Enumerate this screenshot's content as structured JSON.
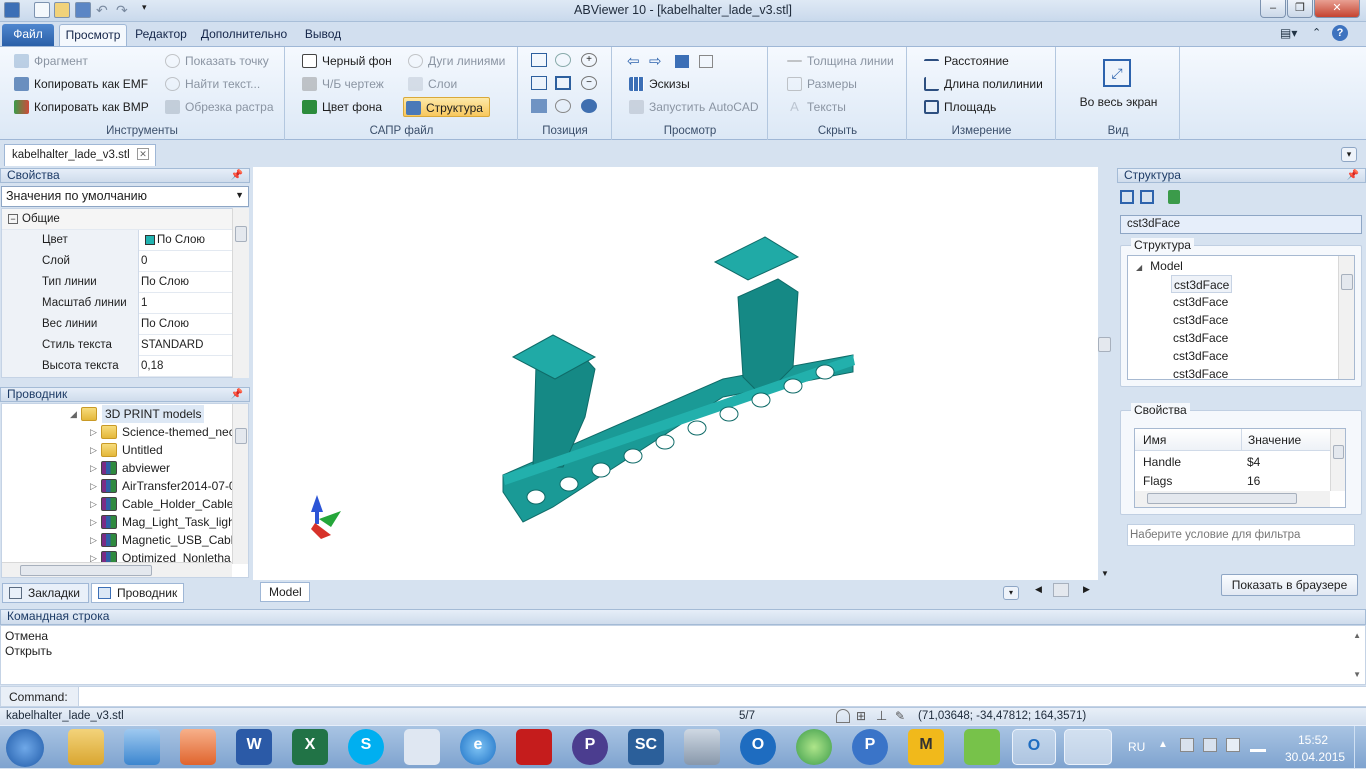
{
  "window": {
    "title": "ABViewer 10 - [kabelhalter_lade_v3.stl]",
    "controls": [
      "–",
      "❐",
      "✕"
    ]
  },
  "quick_access": {
    "icons": [
      "new-icon",
      "open-icon",
      "save-icon",
      "undo-icon",
      "redo-icon",
      "customize-icon"
    ]
  },
  "ribbon": {
    "tabs": [
      "Файл",
      "Просмотр",
      "Редактор",
      "Дополнительно",
      "Вывод"
    ],
    "active_tab": "Просмотр",
    "groups": {
      "tools": {
        "title": "Инструменты",
        "items": [
          "Фрагмент",
          "Копировать как EMF",
          "Копировать как BMP",
          "Показать точку",
          "Найти текст...",
          "Обрезка растра"
        ]
      },
      "cad": {
        "title": "САПР файл",
        "items": [
          "Черный фон",
          "Ч/Б чертеж",
          "Цвет фона",
          "Дуги линиями",
          "Слои",
          "Структура"
        ]
      },
      "position": {
        "title": "Позиция"
      },
      "viewing": {
        "title": "Просмотр",
        "items": [
          "Эскизы",
          "Запустить AutoCAD"
        ]
      },
      "hide": {
        "title": "Скрыть",
        "items": [
          "Толщина линии",
          "Размеры",
          "Тексты"
        ]
      },
      "measure": {
        "title": "Измерение",
        "items": [
          "Расстояние",
          "Длина полилинии",
          "Площадь"
        ]
      },
      "view": {
        "title": "Вид",
        "items": [
          "Во весь экран"
        ]
      }
    }
  },
  "document_tab": {
    "name": "kabelhalter_lade_v3.stl"
  },
  "properties_panel": {
    "title": "Свойства",
    "combo": "Значения по умолчанию",
    "section": "Общие",
    "rows": [
      {
        "key": "Цвет",
        "value": "По Слою"
      },
      {
        "key": "Слой",
        "value": "0"
      },
      {
        "key": "Тип линии",
        "value": "По Слою"
      },
      {
        "key": "Масштаб линии",
        "value": "1"
      },
      {
        "key": "Вес линии",
        "value": "По Слою"
      },
      {
        "key": "Стиль текста",
        "value": "STANDARD"
      },
      {
        "key": "Высота текста",
        "value": "0,18"
      }
    ]
  },
  "explorer_panel": {
    "title": "Проводник",
    "root": "3D PRINT models",
    "items": [
      {
        "name": "Science-themed_nec",
        "type": "folder"
      },
      {
        "name": "Untitled",
        "type": "folder"
      },
      {
        "name": "abviewer",
        "type": "archive"
      },
      {
        "name": "AirTransfer2014-07-0",
        "type": "archive"
      },
      {
        "name": "Cable_Holder_Cable_",
        "type": "archive"
      },
      {
        "name": "Mag_Light_Task_ligh",
        "type": "archive"
      },
      {
        "name": "Magnetic_USB_Cable",
        "type": "archive"
      },
      {
        "name": "Optimized_Nonletha",
        "type": "archive"
      }
    ]
  },
  "left_bottom_tabs": [
    "Закладки",
    "Проводник"
  ],
  "viewport": {
    "model_tab": "Model",
    "model_color": "#1a9a96"
  },
  "structure_panel": {
    "title": "Структура",
    "selected": "cst3dFace",
    "group_label": "Структура",
    "tree_root": "Model",
    "tree_items": [
      "cst3dFace",
      "cst3dFace",
      "cst3dFace",
      "cst3dFace",
      "cst3dFace",
      "cst3dFace"
    ],
    "props_label": "Свойства",
    "props_headers": [
      "Имя",
      "Значение"
    ],
    "props_rows": [
      {
        "name": "Handle",
        "value": "$4"
      },
      {
        "name": "Flags",
        "value": "16"
      }
    ],
    "filter_placeholder": "Наберите условие для фильтра",
    "browser_button": "Показать в браузере"
  },
  "command_panel": {
    "title": "Командная строка",
    "history": [
      "Отмена",
      "Открыть"
    ],
    "label": "Command:"
  },
  "status_bar": {
    "file": "kabelhalter_lade_v3.stl",
    "page": "5/7",
    "coords": "(71,03648; -34,47812; 164,3571)"
  },
  "taskbar": {
    "lang": "RU",
    "time": "15:52",
    "date": "30.04.2015"
  }
}
